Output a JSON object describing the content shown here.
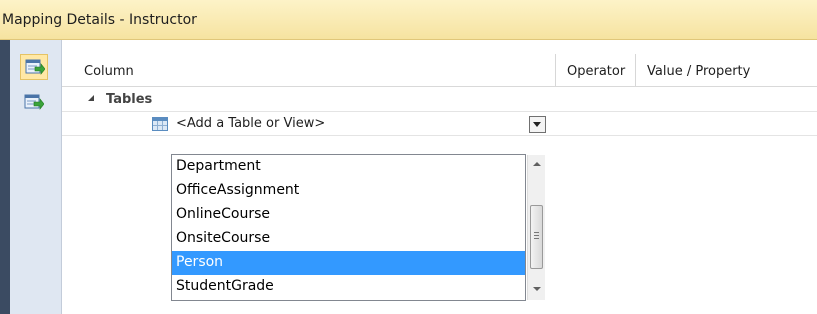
{
  "window": {
    "title": "Mapping Details - Instructor"
  },
  "toolbar": {
    "buttons": [
      {
        "icon": "map-entity-to-tables-icon",
        "selected": true
      },
      {
        "icon": "map-entity-to-functions-icon",
        "selected": false
      }
    ]
  },
  "grid": {
    "columns": [
      "Column",
      "Operator",
      "Value / Property"
    ],
    "group_label": "Tables",
    "add_placeholder": "<Add a Table or View>"
  },
  "dropdown": {
    "items": [
      "Department",
      "OfficeAssignment",
      "OnlineCourse",
      "OnsiteCourse",
      "Person",
      "StudentGrade"
    ],
    "selected": "Person"
  },
  "colors": {
    "title_bar": "#f6e3a0",
    "selection": "#3399ff",
    "toolstrip": "#dfe7f2"
  }
}
